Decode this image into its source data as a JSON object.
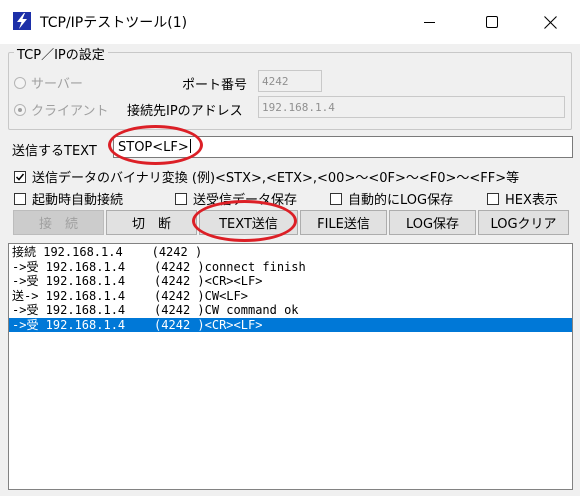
{
  "window": {
    "title": "TCP/IPテストツール(1)",
    "controls": [
      "minimize",
      "maximize",
      "close"
    ]
  },
  "settings": {
    "group_title": "TCP／IPの設定",
    "server_label": "サーバー",
    "client_label": "クライアント",
    "selected_mode": "client",
    "port_label": "ポート番号",
    "port_value": "4242",
    "address_label": "接続先IPのアドレス",
    "address_value": "192.168.1.4"
  },
  "send": {
    "label": "送信するTEXT",
    "value": "STOP<LF>"
  },
  "options": {
    "binary_convert": {
      "label": "送信データのバイナリ変換 (例)<STX>,<ETX>,<00>～<0F>～<F0>～<FF>等",
      "checked": true
    },
    "auto_connect": {
      "label": "起動時自動接続",
      "checked": false
    },
    "save_data": {
      "label": "送受信データ保存",
      "checked": false
    },
    "auto_log": {
      "label": "自動的にLOG保存",
      "checked": false
    },
    "hex_display": {
      "label": "HEX表示",
      "checked": false
    }
  },
  "buttons": {
    "connect": "接　続",
    "disconnect": "切　断",
    "text_send": "TEXT送信",
    "file_send": "FILE送信",
    "log_save": "LOG保存",
    "log_clear": "LOGクリア"
  },
  "log": [
    "接続 192.168.1.4    (4242 )",
    "->受 192.168.1.4    (4242 )connect finish",
    "->受 192.168.1.4    (4242 )<CR><LF>",
    "送-> 192.168.1.4    (4242 )CW<LF>",
    "->受 192.168.1.4    (4242 )CW command ok",
    "->受 192.168.1.4    (4242 )<CR><LF>"
  ],
  "selected_log_index": 5,
  "colors": {
    "selection": "#0078d7",
    "annotation": "#dc1f26",
    "app_icon": "#1c2fa8"
  }
}
